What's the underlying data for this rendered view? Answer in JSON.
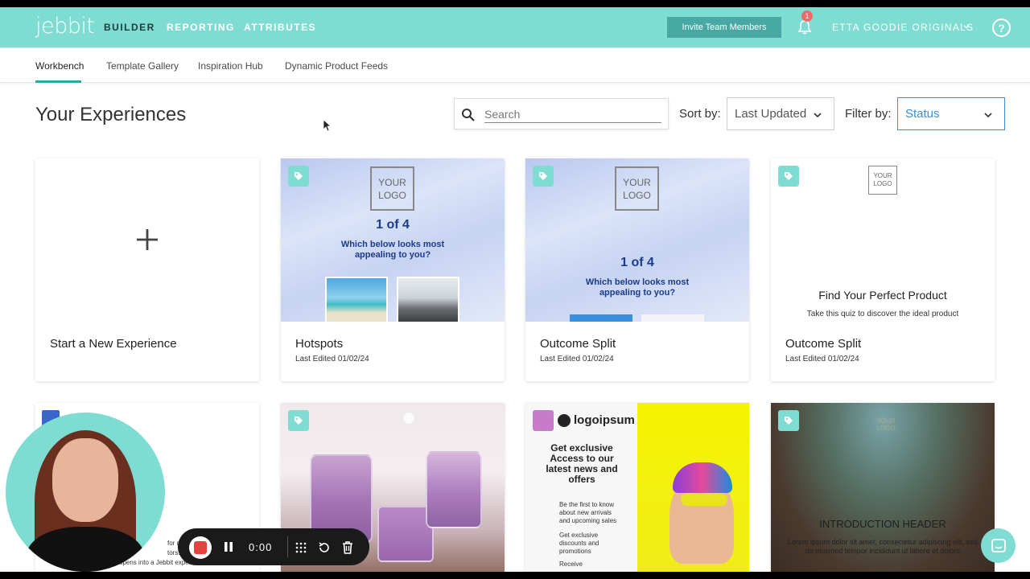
{
  "brand": {
    "logo": "jebbit",
    "accent": "#7fdcd3",
    "accent_dark": "#47a8a4",
    "active_tab": "#2aaa9f",
    "filter_blue": "#3a8fd8"
  },
  "topnav": {
    "items": [
      "BUILDER",
      "REPORTING",
      "ATTRIBUTES"
    ],
    "invite_label": "Invite Team Members",
    "notification_count": "1",
    "account_name": "ETTA GOODIE ORIGINALS",
    "help_label": "?"
  },
  "subnav": {
    "tabs": [
      "Workbench",
      "Template Gallery",
      "Inspiration Hub",
      "Dynamic Product Feeds"
    ],
    "active": "Workbench"
  },
  "main": {
    "title": "Your Experiences",
    "search_placeholder": "Search",
    "sort_label": "Sort by:",
    "sort_value": "Last Updated",
    "filter_label": "Filter by:",
    "filter_value": "Status"
  },
  "cards": [
    {
      "name": "Start a New Experience",
      "date": "",
      "icon": "plus-icon"
    },
    {
      "name": "Hotspots",
      "date": "Last Edited 01/02/24",
      "logo": "YOUR LOGO",
      "count": "1 of 4",
      "question": "Which below looks most appealing to you?"
    },
    {
      "name": "Outcome Split",
      "date": "Last Edited 01/02/24",
      "logo": "YOUR LOGO",
      "count": "1 of 4",
      "question": "Which below looks most appealing to you?"
    },
    {
      "name": "Outcome Split",
      "date": "Last Edited 01/02/24",
      "logo": "YOUR LOGO",
      "headline": "Find Your Perfect Product",
      "sub": "Take this quiz to discover the ideal product"
    }
  ],
  "row2": {
    "card1_text_line1": "for driving sp",
    "card1_text_line2": "tors. It lives as a w",
    "card1_text_line3": "(like jebbit.com), that opens into a Jebbit experience.",
    "card3_brand": "logoipsum",
    "card3_headline": "Get exclusive Access to our latest news and offers",
    "card3_bullet1": "Be the first to know about new arrivals and upcoming sales",
    "card3_bullet2": "Get exclusive discounts and promotions",
    "card3_bullet3": "Receive",
    "card4_header": "INTRODUCTION HEADER",
    "card4_body": "Lorem ipsum dolor sit amet, consectetur adipiscing elit, sed do eiusmod tempor incididunt ut labore et dolore",
    "card4_logo": "YOUR LOGO"
  },
  "recorder": {
    "time": "0:00"
  }
}
